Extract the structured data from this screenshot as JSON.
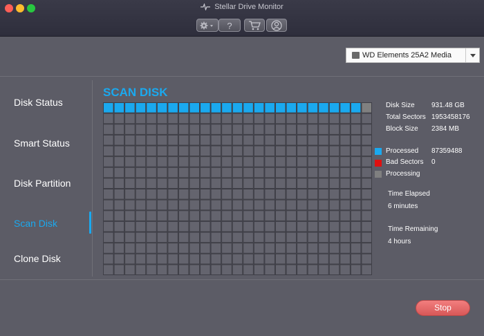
{
  "window": {
    "title": "Stellar Drive Monitor"
  },
  "toolbar": {
    "buttons": [
      "gear-icon",
      "help-icon",
      "cart-icon",
      "user-icon"
    ]
  },
  "drive": {
    "selected": "WD Elements 25A2 Media"
  },
  "nav": {
    "items": [
      {
        "label": "Disk Status"
      },
      {
        "label": "Smart Status"
      },
      {
        "label": "Disk Partition"
      },
      {
        "label": "Scan Disk",
        "active": true
      },
      {
        "label": "Clone Disk"
      }
    ]
  },
  "scan": {
    "title": "SCAN DISK",
    "grid": {
      "columns": 25,
      "rows": 16,
      "processed_blocks": 24,
      "processing_blocks": 1
    },
    "info": [
      {
        "label": "Disk Size",
        "value": "931.48 GB"
      },
      {
        "label": "Total Sectors",
        "value": "1953458176"
      },
      {
        "label": "Block Size",
        "value": "2384 MB"
      }
    ],
    "legend": [
      {
        "label": "Processed",
        "value": "87359488",
        "color": "#1aa9ef"
      },
      {
        "label": "Bad Sectors",
        "value": "0",
        "color": "#e01010"
      },
      {
        "label": "Processing",
        "value": "",
        "color": "#808080"
      }
    ],
    "time_elapsed_label": "Time Elapsed",
    "time_elapsed": "6 minutes",
    "time_remaining_label": "Time Remaining",
    "time_remaining": "4 hours"
  },
  "actions": {
    "stop_label": "Stop"
  },
  "colors": {
    "accent": "#1aa9ef",
    "stop": "#e06666"
  }
}
